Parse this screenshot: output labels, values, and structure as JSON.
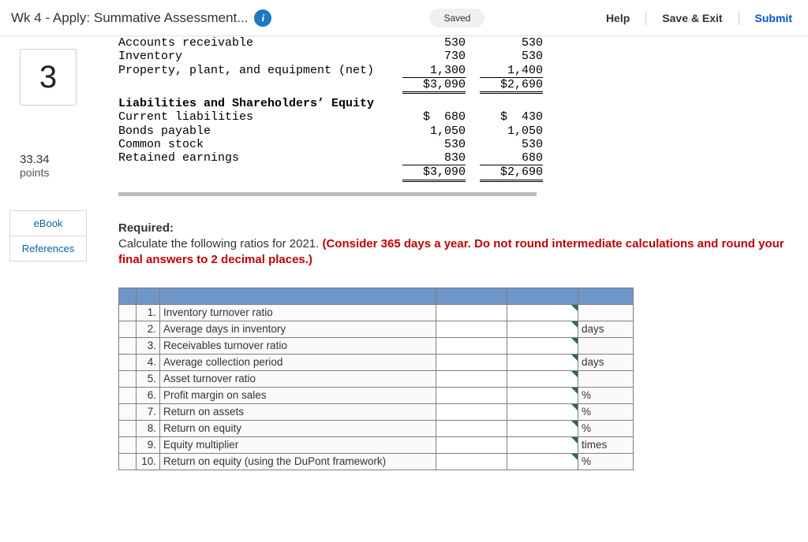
{
  "header": {
    "title": "Wk 4 - Apply: Summative Assessment...",
    "info_glyph": "i",
    "saved": "Saved",
    "help": "Help",
    "save_exit": "Save & Exit",
    "submit": "Submit"
  },
  "question": {
    "number": "3",
    "points_value": "33.34",
    "points_label": "points"
  },
  "links": {
    "ebook": "eBook",
    "references": "References"
  },
  "balance": {
    "rows_top": [
      {
        "label": "Accounts receivable",
        "a": "530",
        "b": "530"
      },
      {
        "label": "Inventory",
        "a": "730",
        "b": "530"
      },
      {
        "label": "Property, plant, and equipment (net)",
        "a": "1,300",
        "b": "1,400",
        "u": true
      }
    ],
    "top_total": {
      "a": "$3,090",
      "b": "$2,690"
    },
    "section_title": "Liabilities and Shareholders’ Equity",
    "rows_bot": [
      {
        "label": "Current liabilities",
        "a": "$  680",
        "b": "$  430"
      },
      {
        "label": "Bonds payable",
        "a": "1,050",
        "b": "1,050"
      },
      {
        "label": "Common stock",
        "a": "530",
        "b": "530"
      },
      {
        "label": "Retained earnings",
        "a": "830",
        "b": "680",
        "u": true
      }
    ],
    "bot_total": {
      "a": "$3,090",
      "b": "$2,690"
    }
  },
  "required": {
    "heading": "Required:",
    "line1": "Calculate the following ratios for 2021. ",
    "red": "(Consider 365 days a year. Do not round intermediate calculations and round your final answers to 2 decimal places.)"
  },
  "answers": [
    {
      "n": "1.",
      "label": "Inventory turnover ratio",
      "unit": ""
    },
    {
      "n": "2.",
      "label": "Average days in inventory",
      "unit": "days"
    },
    {
      "n": "3.",
      "label": "Receivables turnover ratio",
      "unit": ""
    },
    {
      "n": "4.",
      "label": "Average collection period",
      "unit": "days"
    },
    {
      "n": "5.",
      "label": "Asset turnover ratio",
      "unit": ""
    },
    {
      "n": "6.",
      "label": "Profit margin on sales",
      "unit": "%"
    },
    {
      "n": "7.",
      "label": "Return on assets",
      "unit": "%"
    },
    {
      "n": "8.",
      "label": "Return on equity",
      "unit": "%"
    },
    {
      "n": "9.",
      "label": "Equity multiplier",
      "unit": "times"
    },
    {
      "n": "10.",
      "label": "Return on equity (using the DuPont framework)",
      "unit": "%"
    }
  ]
}
